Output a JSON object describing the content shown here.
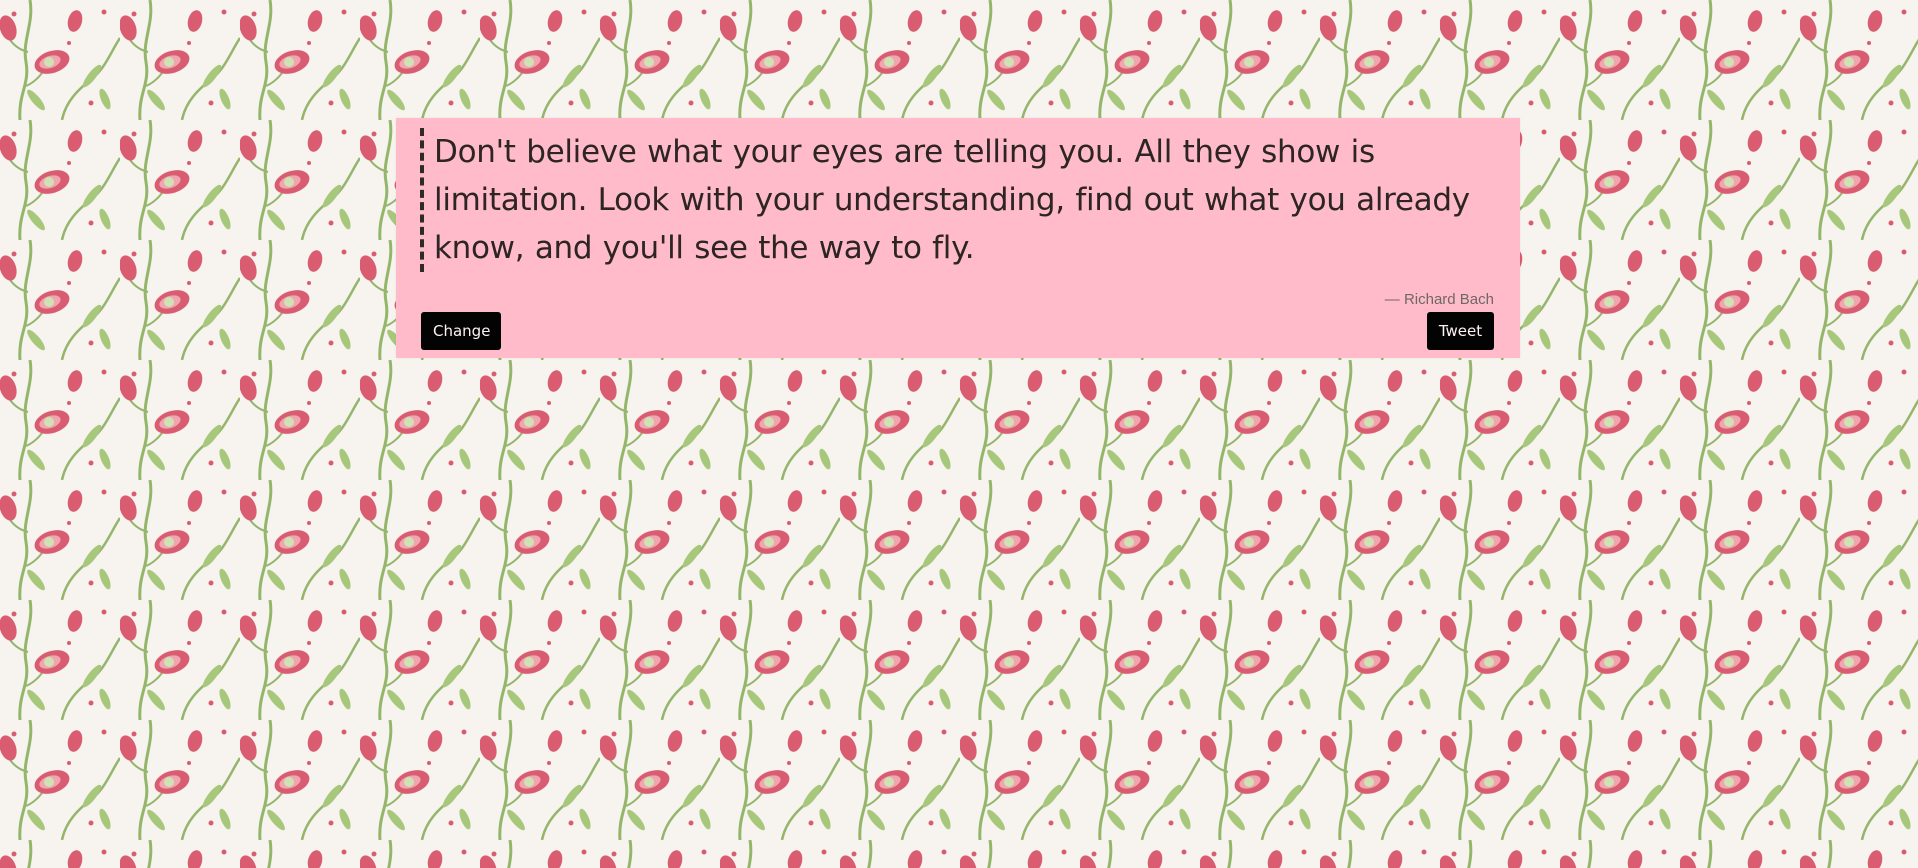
{
  "background": {
    "semantic": "floral-wallpaper-pattern",
    "colors": {
      "base": "#f7f3ee",
      "stem": "#93b66b",
      "leaf": "#a7c77a",
      "flower": "#d95c70",
      "flower_light": "#f0a5b0",
      "center": "#cfe2b3"
    }
  },
  "quote": {
    "text": "Don't believe what your eyes are telling you. All they show is limitation. Look with your understanding, find out what you already know, and you'll see the way to fly.",
    "author": "— Richard Bach"
  },
  "buttons": {
    "change": "Change",
    "tweet": "Tweet"
  },
  "colors": {
    "card_background": "#ffbbc9",
    "button_background": "#030303",
    "button_text": "#fff2f2",
    "quote_text": "#2d2424",
    "author_text": "#6e6868"
  }
}
